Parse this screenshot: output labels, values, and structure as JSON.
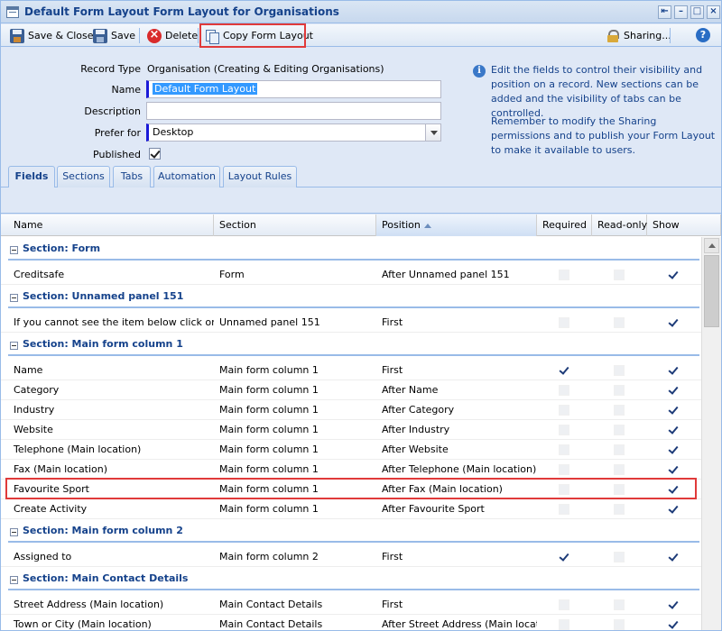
{
  "window": {
    "title": "Default Form Layout Form Layout for Organisations"
  },
  "toolbar": {
    "save_close_label": "Save & Close",
    "save_label": "Save",
    "delete_label": "Delete",
    "copy_label": "Copy Form Layout",
    "sharing_label": "Sharing...",
    "help_glyph": "?"
  },
  "form": {
    "record_type_label": "Record Type",
    "record_type_value": "Organisation (Creating & Editing Organisations)",
    "name_label": "Name",
    "name_value": "Default Form Layout",
    "description_label": "Description",
    "description_value": "",
    "prefer_for_label": "Prefer for",
    "prefer_for_value": "Desktop",
    "published_label": "Published",
    "published_checked": true
  },
  "info": {
    "icon_glyph": "i",
    "paragraph1": "Edit the fields to control their visibility and position on a record. New sections can be added and the visibility of tabs can be controlled.",
    "paragraph2": "Remember to modify the Sharing permissions and to publish your Form Layout to make it available to users."
  },
  "tabs": [
    {
      "label": "Fields",
      "active": true
    },
    {
      "label": "Sections",
      "active": false
    },
    {
      "label": "Tabs",
      "active": false
    },
    {
      "label": "Automation",
      "active": false
    },
    {
      "label": "Layout Rules",
      "active": false
    }
  ],
  "grid": {
    "columns": {
      "name": "Name",
      "section": "Section",
      "position": "Position",
      "required": "Required",
      "readonly": "Read-only",
      "show": "Show"
    },
    "groups": [
      {
        "label": "Section: Form",
        "rows": [
          {
            "name": "Creditsafe",
            "section": "Form",
            "position": "After Unnamed panel 151",
            "required": false,
            "readonly": false,
            "show": true
          }
        ]
      },
      {
        "label": "Section: Unnamed panel 151",
        "rows": [
          {
            "name": "If you cannot see the item below click on t...",
            "section": "Unnamed panel 151",
            "position": "First",
            "required": false,
            "readonly": false,
            "show": true
          }
        ]
      },
      {
        "label": "Section: Main form column 1",
        "rows": [
          {
            "name": "Name",
            "section": "Main form column 1",
            "position": "First",
            "required": true,
            "readonly": false,
            "show": true
          },
          {
            "name": "Category",
            "section": "Main form column 1",
            "position": "After Name",
            "required": false,
            "readonly": false,
            "show": true
          },
          {
            "name": "Industry",
            "section": "Main form column 1",
            "position": "After Category",
            "required": false,
            "readonly": false,
            "show": true
          },
          {
            "name": "Website",
            "section": "Main form column 1",
            "position": "After Industry",
            "required": false,
            "readonly": false,
            "show": true
          },
          {
            "name": "Telephone (Main location)",
            "section": "Main form column 1",
            "position": "After Website",
            "required": false,
            "readonly": false,
            "show": true
          },
          {
            "name": "Fax (Main location)",
            "section": "Main form column 1",
            "position": "After Telephone (Main location)",
            "required": false,
            "readonly": false,
            "show": true
          },
          {
            "name": "Favourite Sport",
            "section": "Main form column 1",
            "position": "After Fax (Main location)",
            "required": false,
            "readonly": false,
            "show": true,
            "highlighted": true
          },
          {
            "name": "Create Activity",
            "section": "Main form column 1",
            "position": "After Favourite Sport",
            "required": false,
            "readonly": false,
            "show": true
          }
        ]
      },
      {
        "label": "Section: Main form column 2",
        "rows": [
          {
            "name": "Assigned to",
            "section": "Main form column 2",
            "position": "First",
            "required": true,
            "readonly": false,
            "show": true
          }
        ]
      },
      {
        "label": "Section: Main Contact Details",
        "rows": [
          {
            "name": "Street Address (Main location)",
            "section": "Main Contact Details",
            "position": "First",
            "required": false,
            "readonly": false,
            "show": true
          },
          {
            "name": "Town or City (Main location)",
            "section": "Main Contact Details",
            "position": "After Street Address (Main locati",
            "required": false,
            "readonly": false,
            "show": true
          }
        ]
      }
    ]
  },
  "colors": {
    "title_text": "#15428b",
    "highlight_border": "#e03a3a",
    "panel_bg": "#dfe8f6"
  }
}
